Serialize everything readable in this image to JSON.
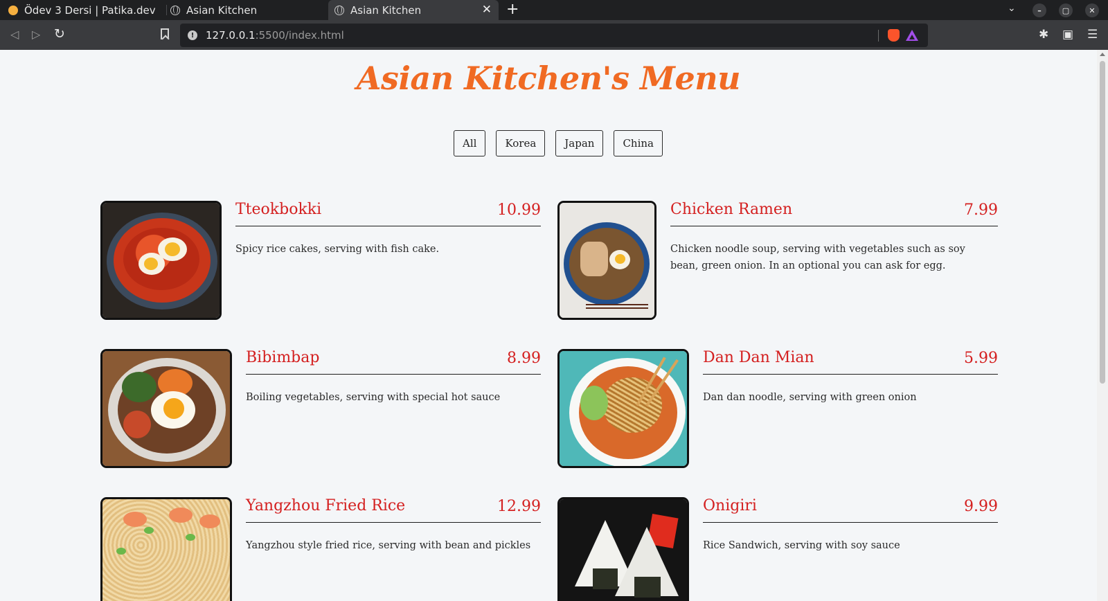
{
  "browser": {
    "tabs": [
      {
        "title": "Ödev 3 Dersi | Patika.dev",
        "active": false
      },
      {
        "title": "Asian Kitchen",
        "active": false
      },
      {
        "title": "Asian Kitchen",
        "active": true
      }
    ],
    "url_host": "127.0.0.1",
    "url_path": ":5500/index.html",
    "icons": {
      "back": "back-icon",
      "forward": "forward-icon",
      "reload": "reload-icon",
      "bookmark": "bookmark-icon",
      "extensions": "puzzle-icon",
      "wallet": "wallet-icon",
      "menu": "hamburger-icon"
    }
  },
  "page": {
    "title": "Asian Kitchen's Menu",
    "accent_color": "#f06a23",
    "price_color": "#d42020",
    "filters": [
      "All",
      "Korea",
      "Japan",
      "China"
    ],
    "items": [
      {
        "name": "Tteokbokki",
        "price": "10.99",
        "desc": "Spicy rice cakes, serving with fish cake."
      },
      {
        "name": "Chicken Ramen",
        "price": "7.99",
        "desc": "Chicken noodle soup, serving with vegetables such as soy bean, green onion. In an optional you can ask for egg."
      },
      {
        "name": "Bibimbap",
        "price": "8.99",
        "desc": "Boiling vegetables, serving with special hot sauce"
      },
      {
        "name": "Dan Dan Mian",
        "price": "5.99",
        "desc": "Dan dan noodle, serving with green onion"
      },
      {
        "name": "Yangzhou Fried Rice",
        "price": "12.99",
        "desc": "Yangzhou style fried rice, serving with bean and pickles"
      },
      {
        "name": "Onigiri",
        "price": "9.99",
        "desc": "Rice Sandwich, serving with soy sauce"
      }
    ]
  }
}
